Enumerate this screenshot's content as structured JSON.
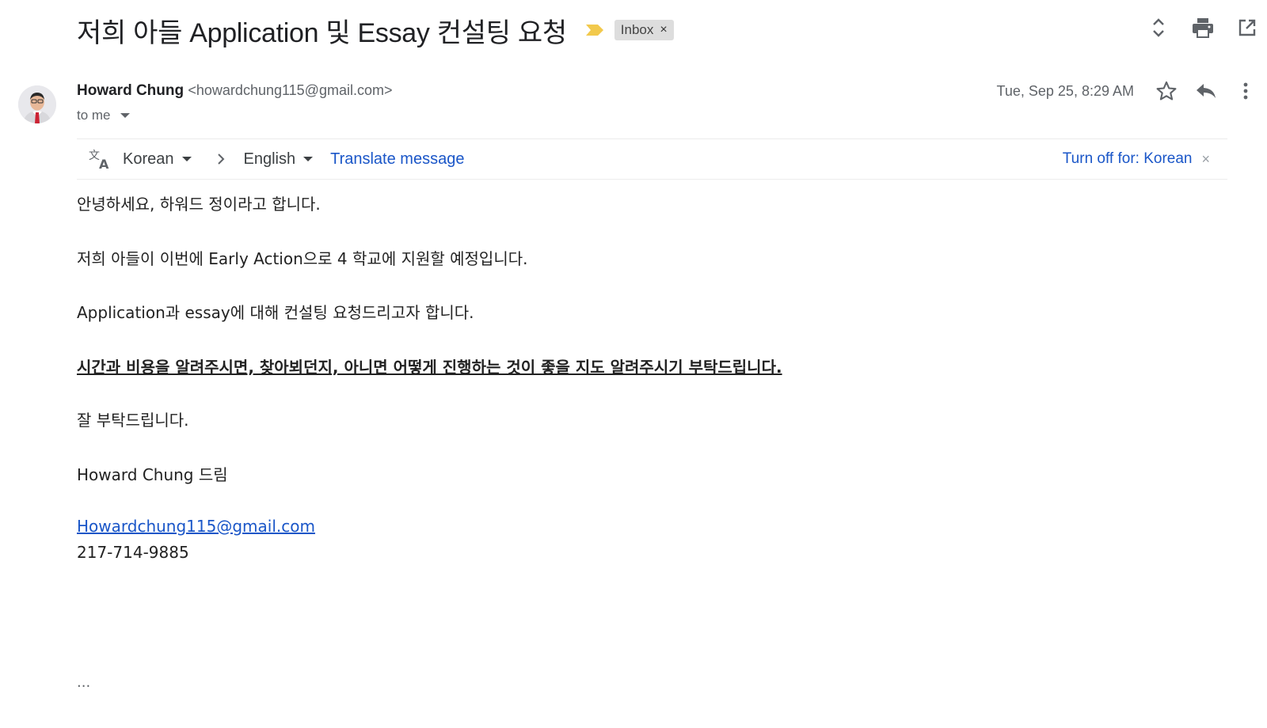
{
  "subject": "저희 아들 Application 및 Essay 컨설팅 요청",
  "label": {
    "name": "Inbox",
    "remove": "×"
  },
  "sender": {
    "name": "Howard Chung",
    "email": "<howardchung115@gmail.com>",
    "recipient": "to me",
    "date": "Tue, Sep 25, 8:29 AM"
  },
  "translate": {
    "from_lang": "Korean",
    "to_lang": "English",
    "action": "Translate message",
    "turn_off": "Turn off for: Korean",
    "close": "×"
  },
  "body": {
    "line1": "안녕하세요, 하워드 정이라고 합니다.",
    "line2": "저희 아들이 이번에 Early Action으로 4 학교에 지원할 예정입니다.",
    "line3": "Application과 essay에 대해 컨설팅 요청드리고자 합니다.",
    "line4": "시간과 비용을 알려주시면, 찾아뵈던지, 아니면 어떻게 진행하는 것이 좋을 지도 알려주시기 부탁드립니다.",
    "line5": "잘 부탁드립니다.",
    "signature": "Howard Chung 드림",
    "email": "Howardchung115@gmail.com",
    "phone": "217-714-9885",
    "trimmed": "..."
  },
  "colors": {
    "link": "#1a56c8",
    "importance": "#f2c94c",
    "chip_bg": "#dddddd"
  },
  "icons": [
    "importance-marker-icon",
    "expand-collapse-icon",
    "print-icon",
    "open-in-new-window-icon",
    "star-icon",
    "reply-icon",
    "more-vert-icon",
    "translate-icon",
    "chevron-right-icon"
  ]
}
